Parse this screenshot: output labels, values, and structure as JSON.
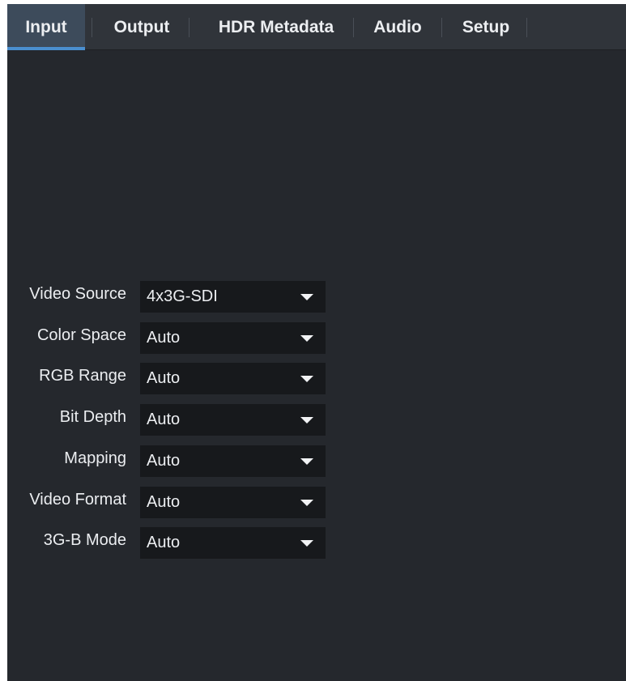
{
  "tabs": [
    {
      "label": "Input",
      "active": true
    },
    {
      "label": "Output",
      "active": false
    },
    {
      "label": "HDR Metadata",
      "active": false
    },
    {
      "label": "Audio",
      "active": false
    },
    {
      "label": "Setup",
      "active": false
    }
  ],
  "fields": [
    {
      "label": "Video Source",
      "value": "4x3G-SDI"
    },
    {
      "label": "Color Space",
      "value": "Auto"
    },
    {
      "label": "RGB Range",
      "value": "Auto"
    },
    {
      "label": "Bit Depth",
      "value": "Auto"
    },
    {
      "label": "Mapping",
      "value": "Auto"
    },
    {
      "label": "Video Format",
      "value": "Auto"
    },
    {
      "label": "3G-B Mode",
      "value": "Auto"
    }
  ],
  "icons": {
    "dropdown": "chevron-down-icon"
  },
  "colors": {
    "background": "#25282d",
    "tab_bar": "#30343a",
    "active_tab": "#3d4b5b",
    "active_tab_underline": "#4a8fd0",
    "select_background": "#17191c",
    "text": "#eceef1"
  }
}
